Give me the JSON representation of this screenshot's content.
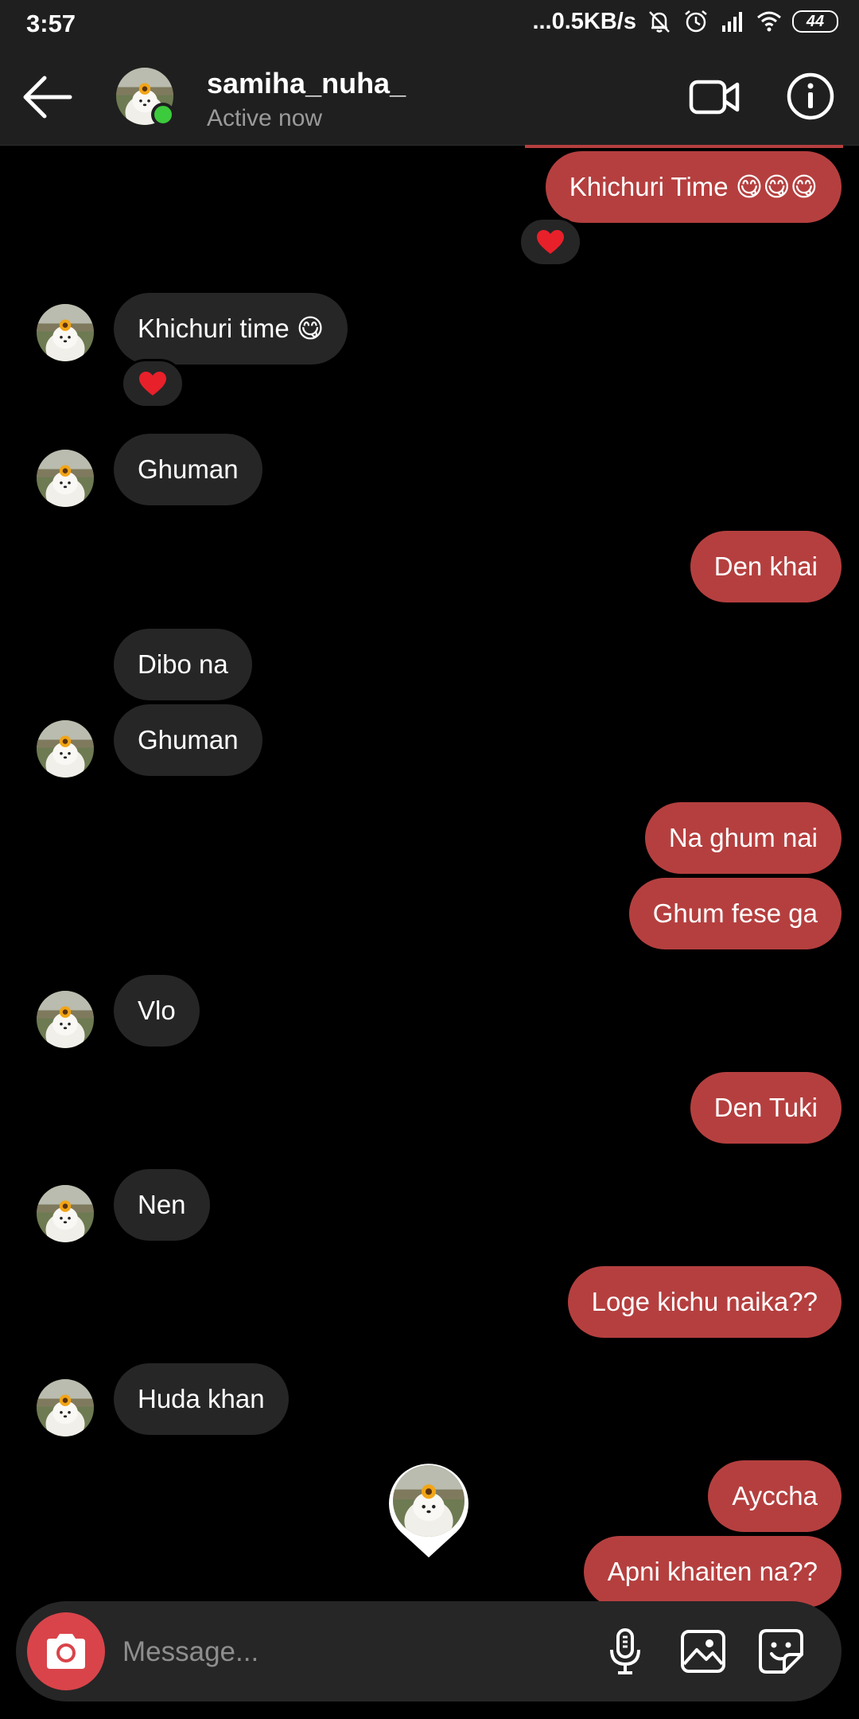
{
  "status_bar": {
    "time": "3:57",
    "network_speed": "...0.5KB/s",
    "battery": "44"
  },
  "header": {
    "username": "samiha_nuha_",
    "status": "Active now"
  },
  "messages": [
    {
      "text": "Khichuri Time 😋😋😋",
      "from": "me",
      "reaction": "heart"
    },
    {
      "text": "Khichuri time 😋",
      "from": "them",
      "reaction": "heart"
    },
    {
      "text": "Ghuman",
      "from": "them"
    },
    {
      "text": "Den khai",
      "from": "me"
    },
    {
      "text": "Dibo na",
      "from": "them"
    },
    {
      "text": "Ghuman",
      "from": "them"
    },
    {
      "text": "Na ghum nai",
      "from": "me"
    },
    {
      "text": "Ghum fese ga",
      "from": "me"
    },
    {
      "text": "Vlo",
      "from": "them"
    },
    {
      "text": "Den Tuki",
      "from": "me"
    },
    {
      "text": "Nen",
      "from": "them"
    },
    {
      "text": "Loge kichu naika??",
      "from": "me"
    },
    {
      "text": "Huda khan",
      "from": "them"
    },
    {
      "text": "Ayccha",
      "from": "me"
    },
    {
      "text": "Apni khaiten na??",
      "from": "me"
    }
  ],
  "composer": {
    "placeholder": "Message..."
  },
  "colors": {
    "outgoing_bubble": "#b53f3f",
    "incoming_bubble": "#262626",
    "online": "#3ccb3c",
    "camera_button": "#d9444a"
  }
}
